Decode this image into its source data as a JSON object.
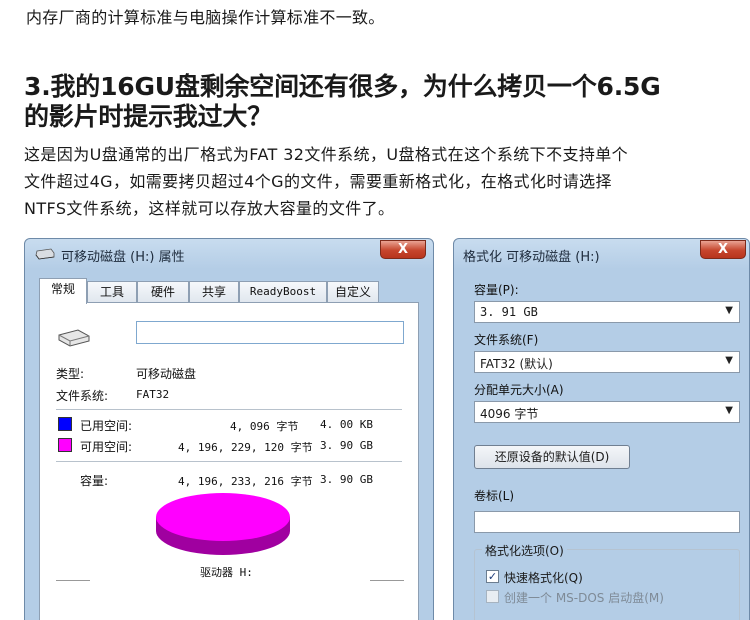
{
  "article": {
    "top_line": "内存厂商的计算标准与电脑操作计算标准不一致。",
    "heading_line1": "3.我的16GU盘剩余空间还有很多，为什么拷贝一个6.5G",
    "heading_line2": "的影片时提示我过大？",
    "body_line1": "这是因为U盘通常的出厂格式为FAT 32文件系统，U盘格式在这个系统下不支持单个",
    "body_line2": "文件超过4G，如需要拷贝超过4个G的文件，需要重新格式化，在格式化时请选择",
    "body_line3": "NTFS文件系统，这样就可以存放大容量的文件了。"
  },
  "properties_dialog": {
    "title": "可移动磁盘 (H:) 属性",
    "close_label": "X",
    "tabs": [
      "常规",
      "工具",
      "硬件",
      "共享",
      "ReadyBoost",
      "自定义"
    ],
    "name_value": "",
    "type_label": "类型:",
    "type_value": "可移动磁盘",
    "fs_label": "文件系统:",
    "fs_value": "FAT32",
    "used_label": "已用空间:",
    "used_bytes": "4, 096 字节",
    "used_size": "4. 00 KB",
    "free_label": "可用空间:",
    "free_bytes": "4, 196, 229, 120 字节",
    "free_size": "3. 90 GB",
    "capacity_label": "容量:",
    "capacity_bytes": "4, 196, 233, 216 字节",
    "capacity_size": "3. 90 GB",
    "drive_label": "驱动器 H:",
    "colors": {
      "used": "#0000ff",
      "free": "#ff00ff"
    }
  },
  "format_dialog": {
    "title": "格式化 可移动磁盘 (H:)",
    "close_label": "X",
    "capacity_label": "容量(P):",
    "capacity_value": "3. 91 GB",
    "fs_label": "文件系统(F)",
    "fs_value": "FAT32 (默认)",
    "alloc_label": "分配单元大小(A)",
    "alloc_value": "4096 字节",
    "restore_button": "还原设备的默认值(D)",
    "volume_label": "卷标(L)",
    "volume_value": "",
    "options_title": "格式化选项(O)",
    "quick_format_label": "快速格式化(Q)",
    "quick_format_checked": true,
    "msdos_label": "创建一个 MS-DOS 启动盘(M)",
    "msdos_checked": false
  }
}
